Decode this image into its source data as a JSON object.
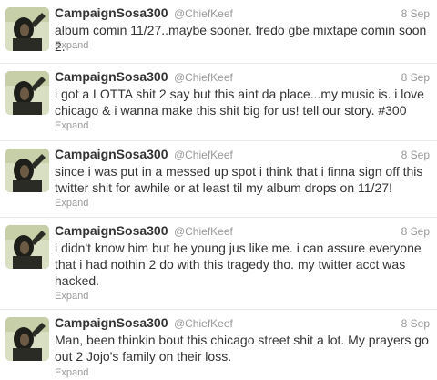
{
  "tweets": [
    {
      "name": "CampaignSosa300",
      "handle": "@ChiefKeef",
      "time": "8 Sep",
      "lines": [
        "album comin 11/27..maybe sooner. fredo gbe mixtape comin soon 2."
      ],
      "expand": "Expand"
    },
    {
      "name": "CampaignSosa300",
      "handle": "@ChiefKeef",
      "time": "8 Sep",
      "lines": [
        "i got a LOTTA shit 2 say but this aint da place...my music is. i love",
        "chicago & i wanna make this shit big for us! tell our story. #300"
      ],
      "expand": "Expand"
    },
    {
      "name": "CampaignSosa300",
      "handle": "@ChiefKeef",
      "time": "8 Sep",
      "lines": [
        "since i was put in a messed up spot i think that i finna sign off this",
        "twitter shit for awhile or at least til my album drops on 11/27!"
      ],
      "expand": "Expand"
    },
    {
      "name": "CampaignSosa300",
      "handle": "@ChiefKeef",
      "time": "8 Sep",
      "lines": [
        "i didn't know him but he young jus like me. i can assure everyone",
        "that i had nothin 2 do with this tragedy tho. my twitter acct was",
        "hacked."
      ],
      "expand": "Expand"
    },
    {
      "name": "CampaignSosa300",
      "handle": "@ChiefKeef",
      "time": "8 Sep",
      "lines": [
        "Man, been thinkin bout this chicago street shit a lot. My prayers go",
        "out 2 Jojo's family on their loss."
      ],
      "expand": "Expand"
    }
  ]
}
